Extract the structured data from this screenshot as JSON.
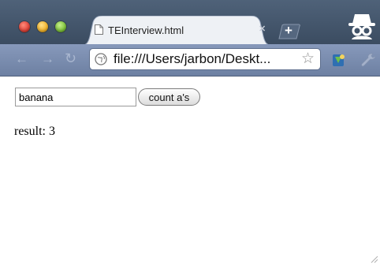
{
  "window": {
    "tab": {
      "title": "TEInterview.html"
    },
    "toolbar": {
      "address": "file:///Users/jarbon/Deskt..."
    }
  },
  "page": {
    "input_value": "banana",
    "button_label": "count a's",
    "result_text": "result: 3"
  },
  "icons": {
    "back": "back-arrow-icon",
    "forward": "forward-arrow-icon",
    "reload": "reload-icon",
    "bookmark": "star-icon",
    "incognito": "incognito-icon",
    "wrench": "wrench-icon",
    "extension": "extension-icon",
    "page": "page-icon",
    "url": "globe-icon"
  },
  "colors": {
    "tabstrip": "#4f6279",
    "toolbar": "#7b8db0",
    "close_red": "#e0443a",
    "minimize_yellow": "#f3b42b",
    "zoom_green": "#7fc23b"
  }
}
